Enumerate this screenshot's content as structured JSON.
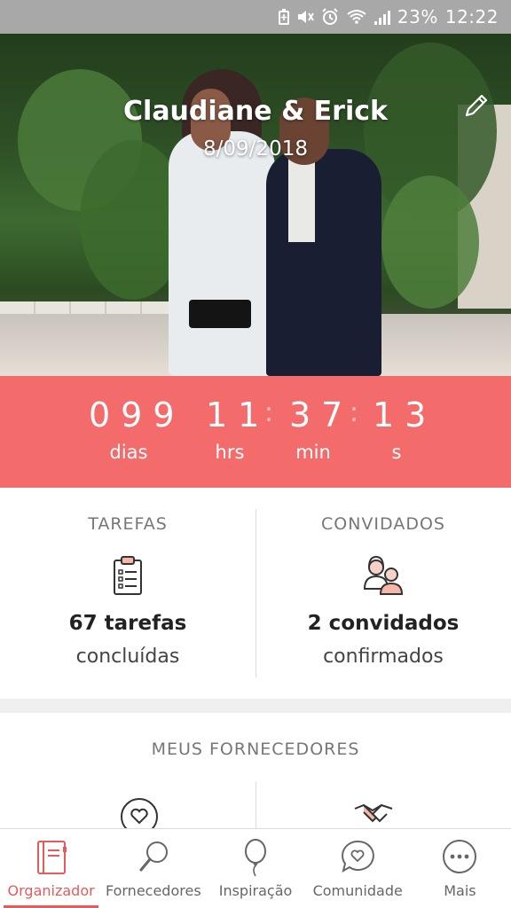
{
  "status_bar": {
    "battery": "23%",
    "time": "12:22",
    "icons": [
      "battery-saver-icon",
      "mute-icon",
      "alarm-icon",
      "wifi-icon",
      "signal-icon"
    ]
  },
  "hero": {
    "couple": "Claudiane & Erick",
    "date": "8/09/2018",
    "edit_icon": "pencil-icon"
  },
  "countdown": {
    "days": "099",
    "hours": "11",
    "minutes": "37",
    "seconds": "13",
    "days_label": "dias",
    "hours_label": "hrs",
    "minutes_label": "min",
    "seconds_label": "s",
    "colors": {
      "background": "#f36b6b"
    }
  },
  "stats": {
    "tasks": {
      "heading": "TAREFAS",
      "value": "67 tarefas",
      "sub": "concluídas",
      "icon": "clipboard-checklist-icon"
    },
    "guests": {
      "heading": "CONVIDADOS",
      "value": "2 convidados",
      "sub": "confirmados",
      "icon": "guests-couple-icon"
    }
  },
  "vendors": {
    "heading": "MEUS FORNECEDORES",
    "icons": [
      "heart-circle-icon",
      "handshake-icon"
    ]
  },
  "nav": {
    "items": [
      {
        "label": "Organizador",
        "icon": "planner-book-icon",
        "active": true
      },
      {
        "label": "Fornecedores",
        "icon": "magnifier-icon",
        "active": false
      },
      {
        "label": "Inspiração",
        "icon": "balloon-icon",
        "active": false
      },
      {
        "label": "Comunidade",
        "icon": "chat-heart-icon",
        "active": false
      },
      {
        "label": "Mais",
        "icon": "more-dots-icon",
        "active": false
      }
    ],
    "colors": {
      "active": "#e55b5b",
      "inactive": "#666666"
    }
  }
}
